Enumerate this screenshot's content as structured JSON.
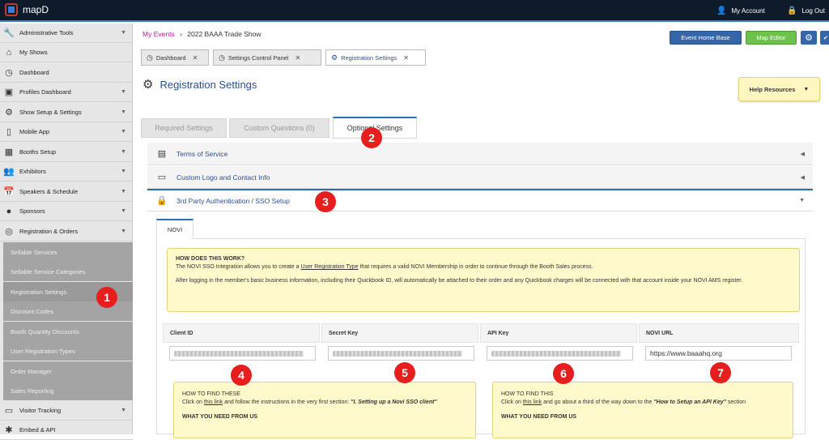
{
  "app": {
    "name": "mapD"
  },
  "topbar": {
    "account": "My Account",
    "logout": "Log Out"
  },
  "sidebar": {
    "items": [
      {
        "label": "Administrative Tools",
        "icon": "wrench-icon",
        "chev": true
      },
      {
        "label": "My Shows",
        "icon": "home-icon",
        "chev": false
      },
      {
        "label": "Dashboard",
        "icon": "gauge-icon",
        "chev": false
      },
      {
        "label": "Profiles Dashboard",
        "icon": "briefcase-icon",
        "chev": true
      },
      {
        "label": "Show Setup & Settings",
        "icon": "gear-icon",
        "chev": true
      },
      {
        "label": "Mobile App",
        "icon": "mobile-icon",
        "chev": true
      },
      {
        "label": "Booths Setup",
        "icon": "grid-icon",
        "chev": true
      },
      {
        "label": "Exhibitors",
        "icon": "users-icon",
        "chev": true
      },
      {
        "label": "Speakers & Schedule",
        "icon": "calendar-icon",
        "chev": true
      },
      {
        "label": "Sponsors",
        "icon": "piggy-bank-icon",
        "chev": true
      },
      {
        "label": "Registration & Orders",
        "icon": "coins-icon",
        "chev": true
      }
    ],
    "subitems": [
      "Sellable Services",
      "Sellable Service Categories",
      "Registration Settings",
      "Discount Codes",
      "Booth Quantity Discounts",
      "User Registration Types",
      "Order Manager",
      "Sales Reporting"
    ],
    "bottom": [
      {
        "label": "Visitor Tracking",
        "icon": "monitor-icon",
        "chev": true
      },
      {
        "label": "Embed & API",
        "icon": "puzzle-icon",
        "chev": false
      }
    ]
  },
  "breadcrumb": {
    "root": "My Events",
    "sep": "›",
    "current": "2022 BAAA Trade Show"
  },
  "buttons": {
    "event_home": "Event Home Base",
    "map_editor": "Map Editor",
    "settings_icon": "⚙"
  },
  "tabs": [
    {
      "label": "Dashboard"
    },
    {
      "label": "Settings Control Panel"
    },
    {
      "label": "Registration Settings"
    }
  ],
  "page": {
    "title": "Registration Settings"
  },
  "help": {
    "label": "Help Resources"
  },
  "subtabs": [
    "Required Settings",
    "Custom Questions (0)",
    "Optional Settings"
  ],
  "accordion": [
    "Terms of Service",
    "Custom Logo and Contact Info",
    "3rd Party Authentication / SSO Setup"
  ],
  "novi_tab": "NOVI",
  "info": {
    "heading": "HOW DOES THIS WORK?",
    "line1_pre": "The NOVI SSO Integration allows you to create a ",
    "line1_link": "User Registration Type",
    "line1_post": " that requires a valid NOVI Membership in order to continue through the Booth Sales process.",
    "line2": "After logging in the member's basic business information, including their Quickbook ID, will automatically be attached to their order and any Quickbook charges will be connected with that account inside your NOVI AMS register."
  },
  "fields": [
    {
      "label": "Client ID",
      "value": ""
    },
    {
      "label": "Secret Key",
      "value": ""
    },
    {
      "label": "API Key",
      "value": ""
    },
    {
      "label": "NOVI URL",
      "value": "https://www.baaahq.org"
    }
  ],
  "find1": {
    "heading": "HOW TO FIND THESE",
    "pre": "Click on ",
    "link": "this link",
    "mid": " and follow the instructions in the very first section: ",
    "em": "\"I. Setting up a Novi SSO client\"",
    "need": "WHAT YOU NEED FROM US"
  },
  "find2": {
    "heading": "HOW TO FIND THIS",
    "pre": "Click on ",
    "link": "this link",
    "mid": " and go about a third of the way down to the ",
    "em": "\"How to Setup an API Key\"",
    "post": " section",
    "need": "WHAT YOU NEED FROM US"
  },
  "badges": [
    "1",
    "2",
    "3",
    "4",
    "5",
    "6",
    "7"
  ]
}
